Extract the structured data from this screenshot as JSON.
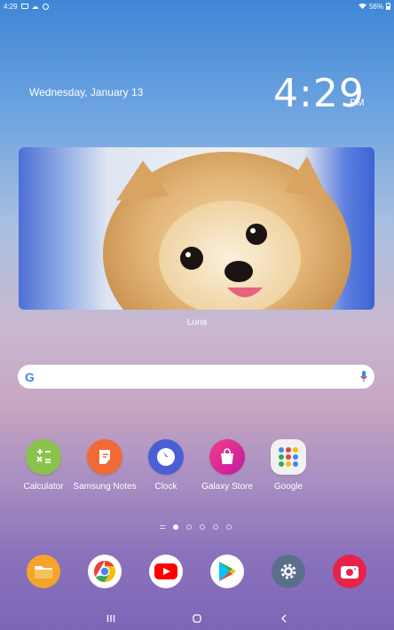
{
  "status_bar": {
    "time": "4:29",
    "battery": "56%"
  },
  "lock": {
    "date": "Wednesday, January 13",
    "time": "4:29",
    "ampm": "PM"
  },
  "photo_widget": {
    "caption": "Luna"
  },
  "search": {
    "logo": "G",
    "icon": "mic-icon"
  },
  "apps": [
    {
      "label": "Calculator",
      "icon": "calculator-icon",
      "color": "#8bc34a"
    },
    {
      "label": "Samsung Notes",
      "icon": "notes-icon",
      "color": "#f06a35"
    },
    {
      "label": "Clock",
      "icon": "clock-icon",
      "color": "#4a5ed6"
    },
    {
      "label": "Galaxy Store",
      "icon": "store-icon",
      "color": "#e32b8c"
    },
    {
      "label": "Google",
      "icon": "google-folder-icon",
      "color": "#f1f1f1"
    }
  ],
  "dock": [
    {
      "icon": "my-files-icon",
      "color": "#f4a42b"
    },
    {
      "icon": "chrome-icon",
      "color": "#ffffff"
    },
    {
      "icon": "youtube-icon",
      "color": "#ffffff"
    },
    {
      "icon": "play-store-icon",
      "color": "#ffffff"
    },
    {
      "icon": "settings-icon",
      "color": "#5a6f8c"
    },
    {
      "icon": "camera-icon",
      "color": "#e8234a"
    }
  ]
}
